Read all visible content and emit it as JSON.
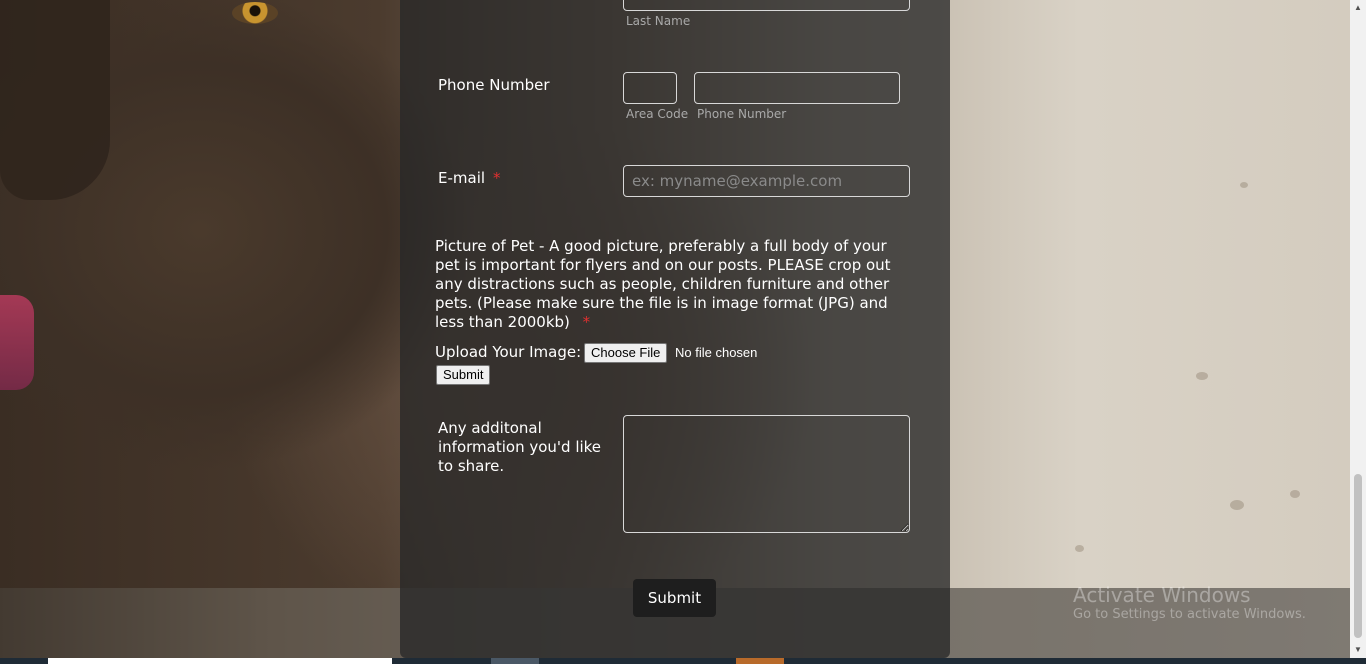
{
  "form": {
    "last_name_sublabel": "Last Name",
    "phone": {
      "label": "Phone Number",
      "area_code_sublabel": "Area Code",
      "number_sublabel": "Phone Number",
      "area_code_value": "",
      "number_value": ""
    },
    "email": {
      "label": "E-mail",
      "required_mark": "*",
      "placeholder": "ex: myname@example.com",
      "value": ""
    },
    "picture": {
      "description": "Picture of Pet - A good picture, preferably a full body of your pet is important for flyers and on our posts. PLEASE crop out any distractions such as people, children furniture and other pets. (Please make sure the file is in image format (JPG) and less than 2000kb)",
      "required_mark": "*",
      "upload_label": "Upload Your Image:",
      "choose_file_label": "Choose File",
      "no_file_text": "No file chosen",
      "submit_label": "Submit"
    },
    "additional": {
      "label": "Any additonal information you'd like to share.",
      "value": ""
    },
    "submit_label": "Submit"
  },
  "watermark": {
    "title": "Activate Windows",
    "subtitle": "Go to Settings to activate Windows."
  },
  "colors": {
    "panel_bg": "rgba(40,40,40,0.78)",
    "required": "#e03030",
    "submit_bg": "#1e1e1e",
    "sublabel": "#a9a9a9"
  },
  "icons": {
    "scroll_up": "scroll-up-arrow-icon",
    "scroll_down": "scroll-down-arrow-icon"
  }
}
